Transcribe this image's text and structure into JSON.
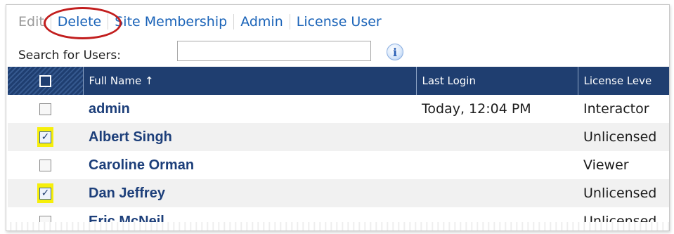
{
  "toolbar": {
    "edit": "Edit",
    "delete": "Delete",
    "site_membership": "Site Membership",
    "admin": "Admin",
    "license_user": "License User"
  },
  "search": {
    "label": "Search for Users:",
    "value": "",
    "info_symbol": "i"
  },
  "columns": {
    "full_name": "Full Name ↑",
    "last_login": "Last Login",
    "license_level": "License Leve"
  },
  "rows": [
    {
      "checked": false,
      "name": "admin",
      "last_login": "Today, 12:04 PM",
      "license": "Interactor"
    },
    {
      "checked": true,
      "name": "Albert Singh",
      "last_login": "",
      "license": "Unlicensed"
    },
    {
      "checked": false,
      "name": "Caroline Orman",
      "last_login": "",
      "license": "Viewer"
    },
    {
      "checked": true,
      "name": "Dan Jeffrey",
      "last_login": "",
      "license": "Unlicensed"
    },
    {
      "checked": false,
      "name": "Eric McNeil",
      "last_login": "",
      "license": "Unlicensed"
    }
  ],
  "colors": {
    "header_bg": "#1f3e70",
    "link": "#1a63b8",
    "highlight": "#f6ef0a",
    "circle": "#c21e1e"
  }
}
